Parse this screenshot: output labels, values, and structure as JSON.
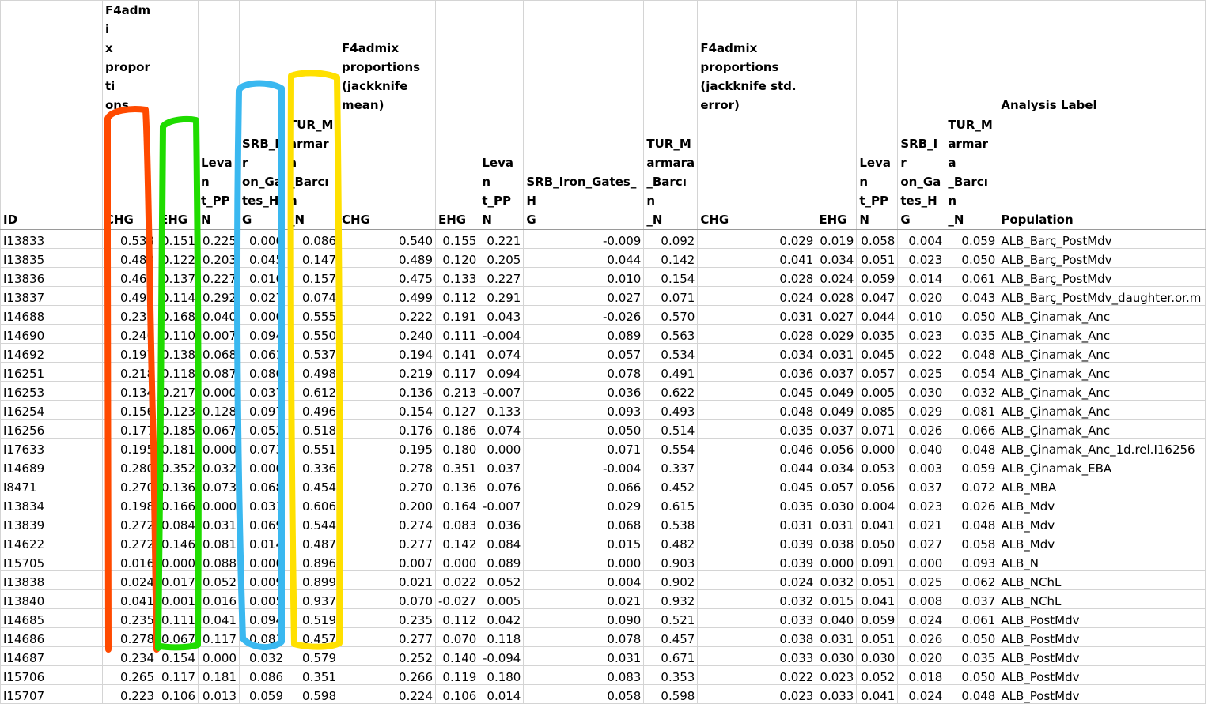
{
  "header_row1": [
    "",
    "F4admix proportions",
    "",
    "",
    "",
    "",
    "F4admix proportions (jackknife mean)",
    "",
    "",
    "",
    "",
    "F4admix proportions (jackknife std. error)",
    "",
    "",
    "",
    "",
    "Analysis Label"
  ],
  "header_row1_display": {
    "b": "F4admi\nx\nproporti\nons",
    "g": "F4admix\nproportions\n(jackknife\nmean)",
    "l": "F4admix\nproportions\n(jackknife std.\nerror)",
    "q": "Analysis Label"
  },
  "header_row2": [
    "ID",
    "CHG",
    "EHG",
    "Levant_PPN",
    "SRB_Iron_Gates_HG",
    "TUR_Marmara_Barcın_N",
    "CHG",
    "EHG",
    "Levant_PPN",
    "SRB_Iron_Gates_HG",
    "TUR_Marmara_Barcın_N",
    "CHG",
    "EHG",
    "Levant_PPN",
    "SRB_Iron_Gates_HG",
    "TUR_Marmara_Barcın_N",
    "Population"
  ],
  "header_row2_display": [
    "ID",
    "CHG",
    "EHG",
    "Levan\nt_PP\nN",
    "SRB_Ir\non_Ga\ntes_HG",
    "TUR_M\narmara\n_Barcın\n_N",
    "CHG",
    "EHG",
    "Levan\nt_PPN",
    "SRB_Iron_Gates_H\nG",
    "TUR_M\narmara\n_Barcın\n_N",
    "CHG",
    "EHG",
    "Levan\nt_PP\nN",
    "SRB_Ir\non_Ga\ntes_HG",
    "TUR_M\narmara\n_Barcın\n_N",
    "Population"
  ],
  "rows": [
    [
      "I13833",
      "0.538",
      "0.151",
      "0.225",
      "0.000",
      "0.086",
      "0.540",
      "0.155",
      "0.221",
      "-0.009",
      "0.092",
      "0.029",
      "0.019",
      "0.058",
      "0.004",
      "0.059",
      "ALB_Barç_PostMdv"
    ],
    [
      "I13835",
      "0.483",
      "0.122",
      "0.203",
      "0.045",
      "0.147",
      "0.489",
      "0.120",
      "0.205",
      "0.044",
      "0.142",
      "0.041",
      "0.034",
      "0.051",
      "0.023",
      "0.050",
      "ALB_Barç_PostMdv"
    ],
    [
      "I13836",
      "0.469",
      "0.137",
      "0.227",
      "0.010",
      "0.157",
      "0.475",
      "0.133",
      "0.227",
      "0.010",
      "0.154",
      "0.028",
      "0.024",
      "0.059",
      "0.014",
      "0.061",
      "ALB_Barç_PostMdv"
    ],
    [
      "I13837",
      "0.493",
      "0.114",
      "0.292",
      "0.027",
      "0.074",
      "0.499",
      "0.112",
      "0.291",
      "0.027",
      "0.071",
      "0.024",
      "0.028",
      "0.047",
      "0.020",
      "0.043",
      "ALB_Barç_PostMdv_daughter.or.m"
    ],
    [
      "I14688",
      "0.237",
      "0.168",
      "0.040",
      "0.000",
      "0.555",
      "0.222",
      "0.191",
      "0.043",
      "-0.026",
      "0.570",
      "0.031",
      "0.027",
      "0.044",
      "0.010",
      "0.050",
      "ALB_Çinamak_Anc"
    ],
    [
      "I14690",
      "0.240",
      "0.110",
      "0.007",
      "0.094",
      "0.550",
      "0.240",
      "0.111",
      "-0.004",
      "0.089",
      "0.563",
      "0.028",
      "0.029",
      "0.035",
      "0.023",
      "0.035",
      "ALB_Çinamak_Anc"
    ],
    [
      "I14692",
      "0.197",
      "0.138",
      "0.068",
      "0.061",
      "0.537",
      "0.194",
      "0.141",
      "0.074",
      "0.057",
      "0.534",
      "0.034",
      "0.031",
      "0.045",
      "0.022",
      "0.048",
      "ALB_Çinamak_Anc"
    ],
    [
      "I16251",
      "0.218",
      "0.118",
      "0.087",
      "0.080",
      "0.498",
      "0.219",
      "0.117",
      "0.094",
      "0.078",
      "0.491",
      "0.036",
      "0.037",
      "0.057",
      "0.025",
      "0.054",
      "ALB_Çinamak_Anc"
    ],
    [
      "I16253",
      "0.134",
      "0.217",
      "0.000",
      "0.037",
      "0.612",
      "0.136",
      "0.213",
      "-0.007",
      "0.036",
      "0.622",
      "0.045",
      "0.049",
      "0.005",
      "0.030",
      "0.032",
      "ALB_Çinamak_Anc"
    ],
    [
      "I16254",
      "0.156",
      "0.123",
      "0.128",
      "0.097",
      "0.496",
      "0.154",
      "0.127",
      "0.133",
      "0.093",
      "0.493",
      "0.048",
      "0.049",
      "0.085",
      "0.029",
      "0.081",
      "ALB_Çinamak_Anc"
    ],
    [
      "I16256",
      "0.177",
      "0.185",
      "0.067",
      "0.052",
      "0.518",
      "0.176",
      "0.186",
      "0.074",
      "0.050",
      "0.514",
      "0.035",
      "0.037",
      "0.071",
      "0.026",
      "0.066",
      "ALB_Çinamak_Anc"
    ],
    [
      "I17633",
      "0.195",
      "0.181",
      "0.000",
      "0.073",
      "0.551",
      "0.195",
      "0.180",
      "0.000",
      "0.071",
      "0.554",
      "0.046",
      "0.056",
      "0.000",
      "0.040",
      "0.048",
      "ALB_Çinamak_Anc_1d.rel.I16256"
    ],
    [
      "I14689",
      "0.280",
      "0.352",
      "0.032",
      "0.000",
      "0.336",
      "0.278",
      "0.351",
      "0.037",
      "-0.004",
      "0.337",
      "0.044",
      "0.034",
      "0.053",
      "0.003",
      "0.059",
      "ALB_Çinamak_EBA"
    ],
    [
      "I8471",
      "0.270",
      "0.136",
      "0.073",
      "0.068",
      "0.454",
      "0.270",
      "0.136",
      "0.076",
      "0.066",
      "0.452",
      "0.045",
      "0.057",
      "0.056",
      "0.037",
      "0.072",
      "ALB_MBA"
    ],
    [
      "I13834",
      "0.198",
      "0.166",
      "0.000",
      "0.031",
      "0.606",
      "0.200",
      "0.164",
      "-0.007",
      "0.029",
      "0.615",
      "0.035",
      "0.030",
      "0.004",
      "0.023",
      "0.026",
      "ALB_Mdv"
    ],
    [
      "I13839",
      "0.272",
      "0.084",
      "0.031",
      "0.069",
      "0.544",
      "0.274",
      "0.083",
      "0.036",
      "0.068",
      "0.538",
      "0.031",
      "0.031",
      "0.041",
      "0.021",
      "0.048",
      "ALB_Mdv"
    ],
    [
      "I14622",
      "0.272",
      "0.146",
      "0.081",
      "0.014",
      "0.487",
      "0.277",
      "0.142",
      "0.084",
      "0.015",
      "0.482",
      "0.039",
      "0.038",
      "0.050",
      "0.027",
      "0.058",
      "ALB_Mdv"
    ],
    [
      "I15705",
      "0.016",
      "0.000",
      "0.088",
      "0.000",
      "0.896",
      "0.007",
      "0.000",
      "0.089",
      "0.000",
      "0.903",
      "0.039",
      "0.000",
      "0.091",
      "0.000",
      "0.093",
      "ALB_N"
    ],
    [
      "I13838",
      "0.024",
      "0.017",
      "0.052",
      "0.009",
      "0.899",
      "0.021",
      "0.022",
      "0.052",
      "0.004",
      "0.902",
      "0.024",
      "0.032",
      "0.051",
      "0.025",
      "0.062",
      "ALB_NChL"
    ],
    [
      "I13840",
      "0.041",
      "0.001",
      "0.016",
      "0.005",
      "0.937",
      "0.070",
      "-0.027",
      "0.005",
      "0.021",
      "0.932",
      "0.032",
      "0.015",
      "0.041",
      "0.008",
      "0.037",
      "ALB_NChL"
    ],
    [
      "I14685",
      "0.235",
      "0.111",
      "0.041",
      "0.094",
      "0.519",
      "0.235",
      "0.112",
      "0.042",
      "0.090",
      "0.521",
      "0.033",
      "0.040",
      "0.059",
      "0.024",
      "0.061",
      "ALB_PostMdv"
    ],
    [
      "I14686",
      "0.278",
      "0.067",
      "0.117",
      "0.081",
      "0.457",
      "0.277",
      "0.070",
      "0.118",
      "0.078",
      "0.457",
      "0.038",
      "0.031",
      "0.051",
      "0.026",
      "0.050",
      "ALB_PostMdv"
    ],
    [
      "I14687",
      "0.234",
      "0.154",
      "0.000",
      "0.032",
      "0.579",
      "0.252",
      "0.140",
      "-0.094",
      "0.031",
      "0.671",
      "0.033",
      "0.030",
      "0.030",
      "0.020",
      "0.035",
      "ALB_PostMdv"
    ],
    [
      "I15706",
      "0.265",
      "0.117",
      "0.181",
      "0.086",
      "0.351",
      "0.266",
      "0.119",
      "0.180",
      "0.083",
      "0.353",
      "0.022",
      "0.023",
      "0.052",
      "0.018",
      "0.050",
      "ALB_PostMdv"
    ],
    [
      "I15707",
      "0.223",
      "0.106",
      "0.013",
      "0.059",
      "0.598",
      "0.224",
      "0.106",
      "0.014",
      "0.058",
      "0.598",
      "0.023",
      "0.033",
      "0.041",
      "0.024",
      "0.048",
      "ALB_PostMdv"
    ]
  ],
  "annotation_colors": {
    "chg_outline": "#ff4a00",
    "ehg_outline": "#1fdc00",
    "srb_outline": "#3ab8f0",
    "tur_outline": "#ffe000"
  }
}
